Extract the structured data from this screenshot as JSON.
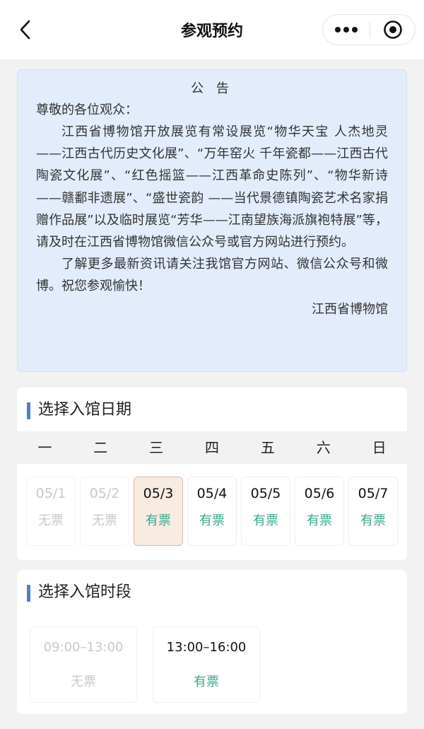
{
  "nav": {
    "title": "参观预约",
    "back_icon": "chevron-left-icon",
    "more_icon": "more-dots-icon",
    "close_icon": "record-close-icon"
  },
  "notice": {
    "title": "公 告",
    "greeting": "尊敬的各位观众：",
    "paragraph1": "江西省博物馆开放展览有常设展览“物华天宝 人杰地灵——江西古代历史文化展”、“万年窑火 千年瓷都——江西古代陶瓷文化展”、“红色摇篮——江西革命史陈列”、“物华新诗——赣鄱非遗展”、“盛世瓷韵 ——当代景德镇陶瓷艺术名家捐赠作品展”以及临时展览“芳华——江南望族海派旗袍特展”等，请及时在江西省博物馆微信公众号或官方网站进行预约。",
    "paragraph2": "了解更多最新资讯请关注我馆官方网站、微信公众号和微博。祝您参观愉快！",
    "signature": "江西省博物馆",
    "background_color": "#e2ecfb"
  },
  "date_section": {
    "title": "选择入馆日期",
    "weekdays": [
      "一",
      "二",
      "三",
      "四",
      "五",
      "六",
      "日"
    ],
    "days": [
      {
        "date": "05/1",
        "status": "无票",
        "available": false,
        "selected": false
      },
      {
        "date": "05/2",
        "status": "无票",
        "available": false,
        "selected": false
      },
      {
        "date": "05/3",
        "status": "有票",
        "available": true,
        "selected": true
      },
      {
        "date": "05/4",
        "status": "有票",
        "available": true,
        "selected": false
      },
      {
        "date": "05/5",
        "status": "有票",
        "available": true,
        "selected": false
      },
      {
        "date": "05/6",
        "status": "有票",
        "available": true,
        "selected": false
      },
      {
        "date": "05/7",
        "status": "有票",
        "available": true,
        "selected": false
      }
    ]
  },
  "time_section": {
    "title": "选择入馆时段",
    "slots": [
      {
        "time": "09:00–13:00",
        "status": "无票",
        "available": false
      },
      {
        "time": "13:00–16:00",
        "status": "有票",
        "available": true
      }
    ]
  },
  "colors": {
    "accent_bar": "#4f7ecf",
    "available_text": "#3aa78e",
    "disabled_text": "#c8c8c8",
    "selected_bg": "#f8ebe2"
  }
}
